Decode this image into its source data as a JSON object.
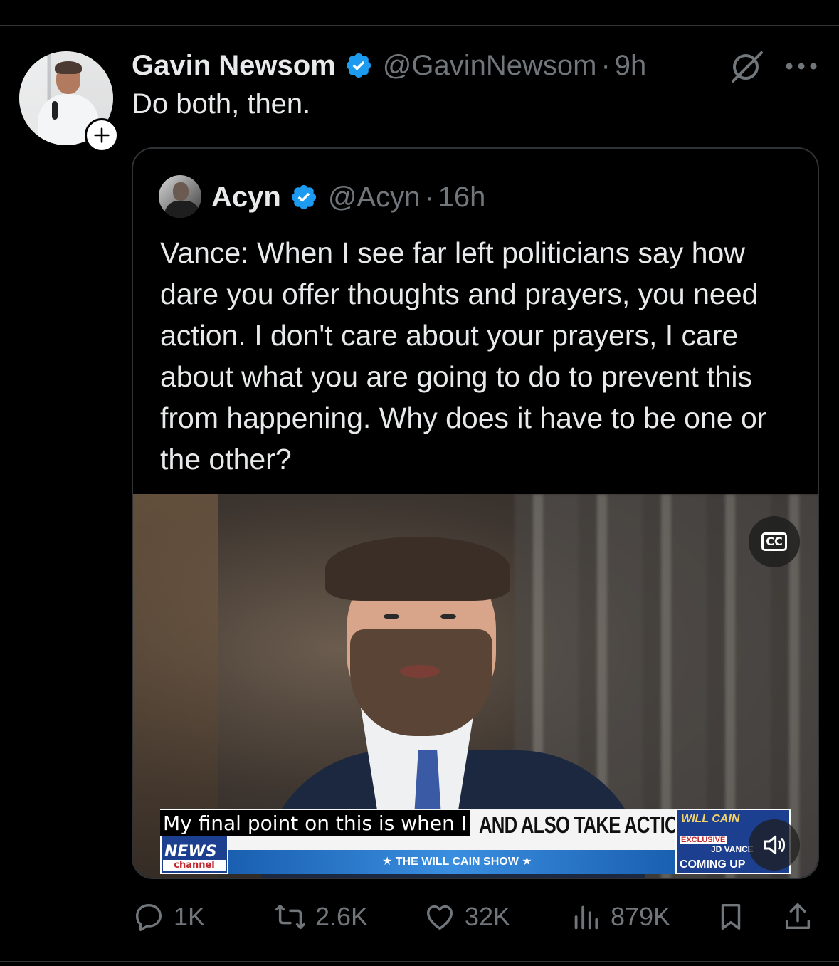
{
  "tweet": {
    "display_name": "Gavin Newsom",
    "handle": "@GavinNewsom",
    "separator": "·",
    "time": "9h",
    "text": "Do both, then."
  },
  "quote": {
    "display_name": "Acyn",
    "handle": "@Acyn",
    "separator": "·",
    "time": "16h",
    "text": "Vance: When I see far left politicians say how dare you offer thoughts and prayers, you need action. I don't care about your prayers, I care about what you are going to do to prevent this from happening. Why does it have to be one or the other?"
  },
  "video": {
    "cc_label": "CC",
    "caption": "My final point on this is when I",
    "headline": "AND ALSO TAKE ACTION",
    "show_strip": "★ THE WILL CAIN SHOW ★",
    "logo_news": "NEWS",
    "logo_channel": "channel",
    "promo_title": "WILL CAIN",
    "promo_exclusive": "EXCLUSIVE",
    "promo_name": "JD VANCE",
    "promo_coming": "COMING UP"
  },
  "actions": {
    "replies": "1K",
    "reposts": "2.6K",
    "likes": "32K",
    "views": "879K"
  },
  "colors": {
    "background": "#000000",
    "text": "#e7e9ea",
    "muted": "#71767b",
    "verified": "#1d9bf0",
    "border": "#2f3336"
  }
}
